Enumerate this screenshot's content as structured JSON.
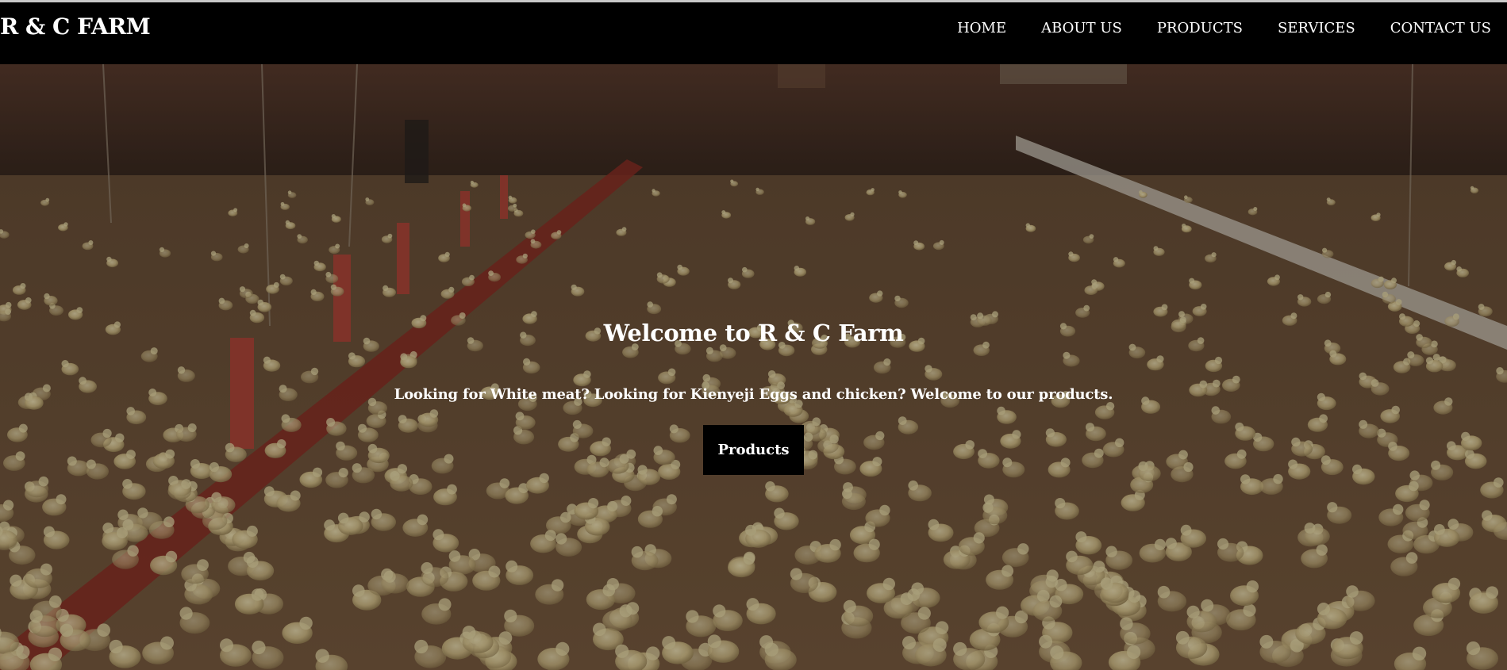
{
  "navbar": {
    "brand": "R & C FARM",
    "links": [
      {
        "label": "HOME"
      },
      {
        "label": "ABOUT US"
      },
      {
        "label": "PRODUCTS"
      },
      {
        "label": "SERVICES"
      },
      {
        "label": "CONTACT US"
      }
    ]
  },
  "hero": {
    "title": "Welcome to R & C Farm",
    "subtitle": "Looking for White meat? Looking for Kienyeji Eggs and chicken? Welcome to our products.",
    "button_label": "Products",
    "background_image": "chicks-in-poultry-house"
  },
  "colors": {
    "navbar_bg": "#000000",
    "text": "#ffffff",
    "button_bg": "#000000",
    "feeder_red": "#c0392b"
  }
}
